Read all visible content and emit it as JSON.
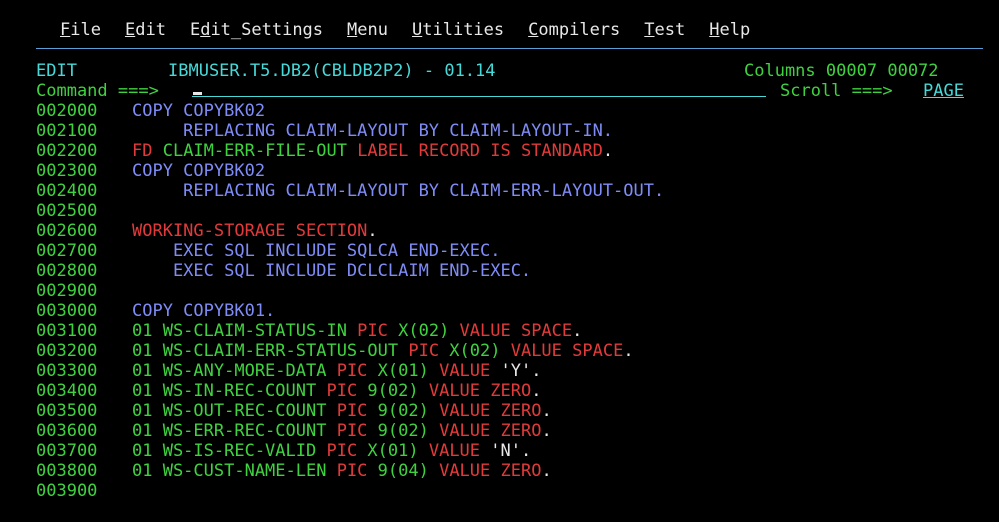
{
  "menu": {
    "items": [
      {
        "hot": "F",
        "rest": "ile"
      },
      {
        "hot": "E",
        "rest": "dit"
      },
      {
        "pre": "E",
        "hot": "d",
        "rest": "it_Settings"
      },
      {
        "hot": "M",
        "rest": "enu"
      },
      {
        "hot": "U",
        "rest": "tilities"
      },
      {
        "hot": "C",
        "rest": "ompilers"
      },
      {
        "hot": "T",
        "rest": "est"
      },
      {
        "hot": "H",
        "rest": "elp"
      }
    ]
  },
  "header": {
    "mode": "EDIT",
    "dataset": "IBMUSER.T5.DB2(CBLDB2P2) - 01.14",
    "columns_label": "Columns",
    "col_from": "00007",
    "col_to": "00072",
    "command_label": "Command ===>",
    "command_value": "",
    "scroll_label": "Scroll ===>",
    "scroll_value": "PAGE"
  },
  "lines": [
    {
      "seq": "002000",
      "parts": [
        {
          "t": "COPY COPYBK02",
          "c": "blue"
        }
      ]
    },
    {
      "seq": "002100",
      "parts": [
        {
          "t": "     REPLACING CLAIM-LAYOUT BY CLAIM-LAYOUT-IN.",
          "c": "blue"
        }
      ]
    },
    {
      "seq": "002200",
      "parts": [
        {
          "t": "FD ",
          "c": "red"
        },
        {
          "t": "CLAIM-ERR-FILE-OUT ",
          "c": "green"
        },
        {
          "t": "LABEL RECORD IS STANDARD",
          "c": "red"
        },
        {
          "t": ".",
          "c": "white"
        }
      ]
    },
    {
      "seq": "002300",
      "parts": [
        {
          "t": "COPY COPYBK02",
          "c": "blue"
        }
      ]
    },
    {
      "seq": "002400",
      "parts": [
        {
          "t": "     REPLACING CLAIM-LAYOUT BY CLAIM-ERR-LAYOUT-OUT.",
          "c": "blue"
        }
      ]
    },
    {
      "seq": "002500",
      "parts": []
    },
    {
      "seq": "002600",
      "parts": [
        {
          "t": "WORKING-STORAGE SECTION",
          "c": "red"
        },
        {
          "t": ".",
          "c": "white"
        }
      ]
    },
    {
      "seq": "002700",
      "parts": [
        {
          "t": "    EXEC SQL INCLUDE SQLCA END-EXEC.",
          "c": "blue"
        }
      ]
    },
    {
      "seq": "002800",
      "parts": [
        {
          "t": "    EXEC SQL INCLUDE DCLCLAIM END-EXEC.",
          "c": "blue"
        }
      ]
    },
    {
      "seq": "002900",
      "parts": []
    },
    {
      "seq": "003000",
      "parts": [
        {
          "t": "COPY COPYBK01.",
          "c": "blue"
        }
      ]
    },
    {
      "seq": "003100",
      "parts": [
        {
          "t": "01 WS-CLAIM-STATUS-IN ",
          "c": "green"
        },
        {
          "t": "PIC ",
          "c": "red"
        },
        {
          "t": "X(02) ",
          "c": "green"
        },
        {
          "t": "VALUE SPACE",
          "c": "red"
        },
        {
          "t": ".",
          "c": "white"
        }
      ]
    },
    {
      "seq": "003200",
      "parts": [
        {
          "t": "01 WS-CLAIM-ERR-STATUS-OUT ",
          "c": "green"
        },
        {
          "t": "PIC ",
          "c": "red"
        },
        {
          "t": "X(02) ",
          "c": "green"
        },
        {
          "t": "VALUE SPACE",
          "c": "red"
        },
        {
          "t": ".",
          "c": "white"
        }
      ]
    },
    {
      "seq": "003300",
      "parts": [
        {
          "t": "01 WS-ANY-MORE-DATA ",
          "c": "green"
        },
        {
          "t": "PIC ",
          "c": "red"
        },
        {
          "t": "X(01) ",
          "c": "green"
        },
        {
          "t": "VALUE ",
          "c": "red"
        },
        {
          "t": "'Y'.",
          "c": "white"
        }
      ]
    },
    {
      "seq": "003400",
      "parts": [
        {
          "t": "01 WS-IN-REC-COUNT ",
          "c": "green"
        },
        {
          "t": "PIC ",
          "c": "red"
        },
        {
          "t": "9(02) ",
          "c": "green"
        },
        {
          "t": "VALUE ZERO",
          "c": "red"
        },
        {
          "t": ".",
          "c": "white"
        }
      ]
    },
    {
      "seq": "003500",
      "parts": [
        {
          "t": "01 WS-OUT-REC-COUNT ",
          "c": "green"
        },
        {
          "t": "PIC ",
          "c": "red"
        },
        {
          "t": "9(02) ",
          "c": "green"
        },
        {
          "t": "VALUE ZERO",
          "c": "red"
        },
        {
          "t": ".",
          "c": "white"
        }
      ]
    },
    {
      "seq": "003600",
      "parts": [
        {
          "t": "01 WS-ERR-REC-COUNT ",
          "c": "green"
        },
        {
          "t": "PIC ",
          "c": "red"
        },
        {
          "t": "9(02) ",
          "c": "green"
        },
        {
          "t": "VALUE ZERO",
          "c": "red"
        },
        {
          "t": ".",
          "c": "white"
        }
      ]
    },
    {
      "seq": "003700",
      "parts": [
        {
          "t": "01 WS-IS-REC-VALID ",
          "c": "green"
        },
        {
          "t": "PIC ",
          "c": "red"
        },
        {
          "t": "X(01) ",
          "c": "green"
        },
        {
          "t": "VALUE ",
          "c": "red"
        },
        {
          "t": "'N'.",
          "c": "white"
        }
      ]
    },
    {
      "seq": "003800",
      "parts": [
        {
          "t": "01 WS-CUST-NAME-LEN ",
          "c": "green"
        },
        {
          "t": "PIC ",
          "c": "red"
        },
        {
          "t": "9(04) ",
          "c": "green"
        },
        {
          "t": "VALUE ZERO",
          "c": "red"
        },
        {
          "t": ".",
          "c": "white"
        }
      ]
    },
    {
      "seq": "003900",
      "parts": []
    }
  ]
}
